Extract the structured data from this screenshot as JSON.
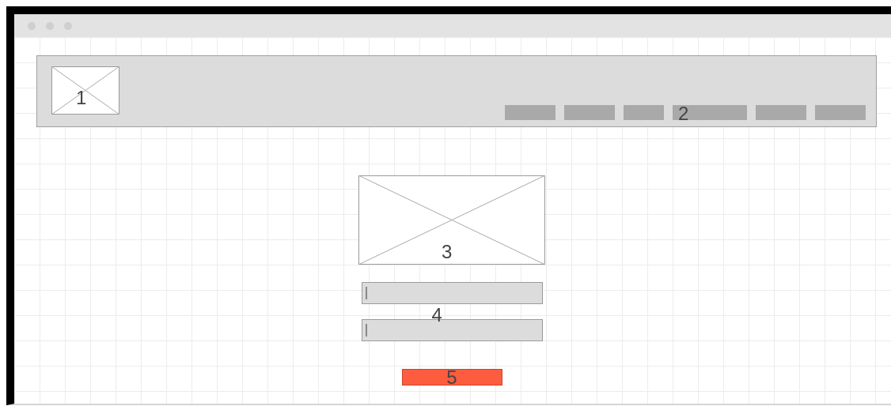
{
  "header": {
    "logo": {
      "label": "1"
    },
    "nav": {
      "label": "2",
      "items": [
        {
          "kind": "medium"
        },
        {
          "kind": "medium"
        },
        {
          "kind": "narrow"
        },
        {
          "kind": "wide"
        },
        {
          "kind": "medium"
        },
        {
          "kind": "medium"
        }
      ]
    }
  },
  "hero_image": {
    "label": "3"
  },
  "form": {
    "label": "4",
    "fields": [
      {
        "kind": "text"
      },
      {
        "kind": "text"
      }
    ]
  },
  "button": {
    "label": "5"
  }
}
